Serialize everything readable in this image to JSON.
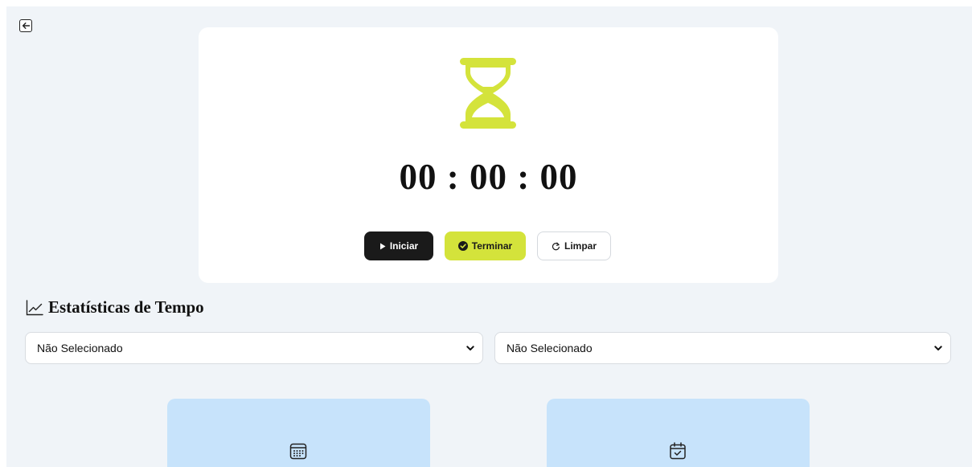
{
  "header": {
    "back_icon": "arrow-left-icon"
  },
  "timer": {
    "icon": "hourglass-icon",
    "display": "00 : 00 : 00",
    "accent_color": "#d4e33b",
    "buttons": {
      "start_label": "Iniciar",
      "finish_label": "Terminar",
      "clear_label": "Limpar"
    }
  },
  "stats": {
    "icon": "line-chart-icon",
    "title": "Estatísticas de Tempo",
    "filters": [
      {
        "selected": "Não Selecionado"
      },
      {
        "selected": "Não Selecionado"
      }
    ],
    "cards": [
      {
        "icon": "calendar-grid-icon",
        "color": "#c7e3fb"
      },
      {
        "icon": "calendar-check-icon",
        "color": "#c7e3fb"
      }
    ]
  }
}
